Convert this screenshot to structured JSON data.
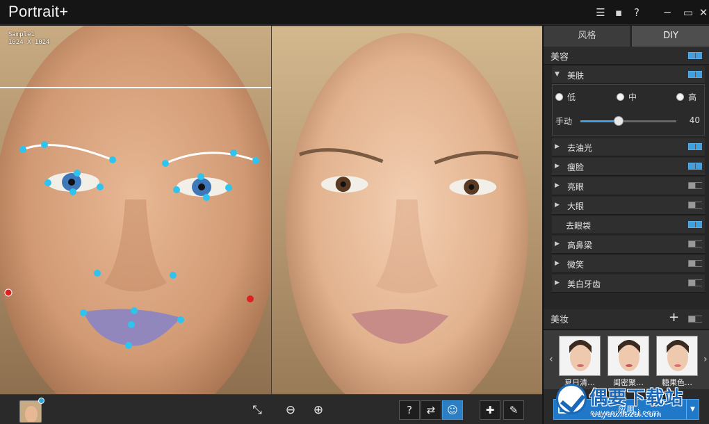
{
  "app": {
    "title": "Portrait+",
    "title_icons": [
      "list-icon",
      "chat-icon",
      "help-icon",
      "minimize-icon",
      "maximize-icon",
      "close-icon"
    ],
    "help_label": "?"
  },
  "canvas": {
    "sample_name": "Sample1",
    "sample_size": "1024 X 1024"
  },
  "bottombar": {
    "help_label": "?"
  },
  "panel": {
    "tabs": [
      {
        "label": "风格",
        "active": false
      },
      {
        "label": "DIY",
        "active": true
      }
    ],
    "beauty_section": {
      "label": "美容",
      "enabled": true
    },
    "skin": {
      "label": "美肤",
      "enabled": true,
      "options": [
        "低",
        "中",
        "高"
      ],
      "manual_label": "手动",
      "manual_value": "40",
      "manual_fraction": 0.4
    },
    "items": [
      {
        "label": "去油光",
        "has_arrow": true,
        "enabled": true
      },
      {
        "label": "瘦脸",
        "has_arrow": true,
        "enabled": true
      },
      {
        "label": "亮眼",
        "has_arrow": true,
        "enabled": false
      },
      {
        "label": "大眼",
        "has_arrow": true,
        "enabled": false
      },
      {
        "label": "去眼袋",
        "has_arrow": false,
        "enabled": true
      },
      {
        "label": "高鼻梁",
        "has_arrow": true,
        "enabled": false
      },
      {
        "label": "微笑",
        "has_arrow": true,
        "enabled": false
      },
      {
        "label": "美白牙齿",
        "has_arrow": true,
        "enabled": false
      }
    ],
    "makeup_section": {
      "label": "美妆",
      "add_label": "+",
      "enabled": false
    },
    "makeup_presets": [
      {
        "caption": "夏日清…"
      },
      {
        "caption": "闺密聚…"
      },
      {
        "caption": "糖果色…"
      }
    ],
    "apply_label": "应用"
  },
  "watermark": {
    "text": "偶要下载站",
    "url": "ouyaoxiazai.com"
  },
  "colors": {
    "accent": "#3f9fe0",
    "landmark": "#2ec4ef",
    "landmark_anchor": "#e02020"
  }
}
